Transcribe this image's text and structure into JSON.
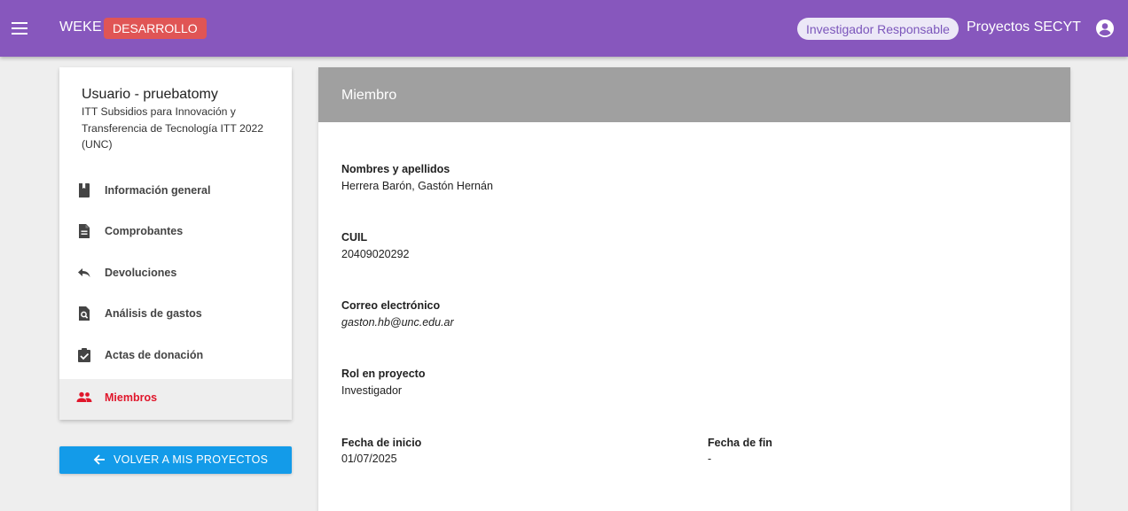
{
  "header": {
    "brand": "WEKE",
    "environment_badge": "DESARROLLO",
    "role_chip": "Investigador Responsable",
    "app_name": "Proyectos SECYT",
    "icons": {
      "menu": "menu-icon",
      "account": "account-circle-icon"
    },
    "colors": {
      "bar": "#8757bd",
      "badge": "#e05555",
      "chip_text": "#7b56bb"
    }
  },
  "sidebar": {
    "title": "Usuario - pruebatomy",
    "subtitle": "ITT Subsidios para Innovación y Transferencia de Tecnología ITT 2022 (UNC)",
    "items": [
      {
        "label": "Información general",
        "icon": "book-icon",
        "active": false
      },
      {
        "label": "Comprobantes",
        "icon": "document-icon",
        "active": false
      },
      {
        "label": "Devoluciones",
        "icon": "reply-icon",
        "active": false
      },
      {
        "label": "Análisis de gastos",
        "icon": "document-search-icon",
        "active": false
      },
      {
        "label": "Actas de donación",
        "icon": "clipboard-check-icon",
        "active": false
      },
      {
        "label": "Miembros",
        "icon": "people-icon",
        "active": true
      }
    ],
    "active_color": "#e0162b",
    "back_button": {
      "label": "VOLVER A MIS PROYECTOS",
      "icon": "arrow-left-icon",
      "color": "#139be9"
    }
  },
  "detail": {
    "title": "Miembro",
    "fields": {
      "nombre": {
        "label": "Nombres y apellidos",
        "value": "Herrera Barón, Gastón Hernán"
      },
      "cuil": {
        "label": "CUIL",
        "value": "20409020292"
      },
      "correo": {
        "label": "Correo electrónico",
        "value": "gaston.hb@unc.edu.ar"
      },
      "rol": {
        "label": "Rol en proyecto",
        "value": "Investigador"
      },
      "inicio": {
        "label": "Fecha de inicio",
        "value": "01/07/2025"
      },
      "fin": {
        "label": "Fecha de fin",
        "value": "-"
      }
    }
  }
}
